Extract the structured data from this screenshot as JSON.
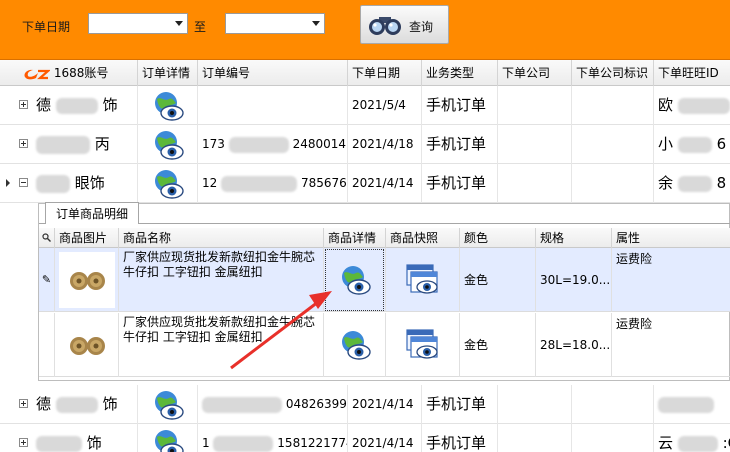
{
  "filter": {
    "date_label": "下单日期",
    "to_label": "至",
    "start_date_value": "",
    "end_date_value": "",
    "query_label": "查询"
  },
  "columns": [
    "1688账号",
    "订单详情",
    "订单编号",
    "下单日期",
    "业务类型",
    "下单公司",
    "下单公司标识",
    "下单旺旺ID"
  ],
  "orders": [
    {
      "account": "德",
      "account_suffix": "饰",
      "order_no": "",
      "date": "2021/5/4",
      "type": "手机订单",
      "wangwang": "欧"
    },
    {
      "account": "",
      "account_suffix": "丙",
      "order_no_prefix": "173",
      "order_no_suffix": "2480014",
      "date": "2021/4/18",
      "type": "手机订单",
      "wangwang": "小",
      "wangwang_suffix": "6"
    },
    {
      "account": "",
      "account_suffix": "眼饰",
      "order_no_prefix": "12",
      "order_no_suffix": "785676",
      "date": "2021/4/14",
      "type": "手机订单",
      "wangwang": "余",
      "wangwang_suffix": "8"
    },
    {
      "account": "德",
      "account_suffix": "饰",
      "order_no_suffix": "04826399",
      "date": "2021/4/14",
      "type": "手机订单",
      "wangwang": ""
    },
    {
      "account": "",
      "account_suffix": "饰",
      "order_no_prefix": "1",
      "order_no_suffix": "1581221774",
      "date": "2021/4/14",
      "type": "手机订单",
      "wangwang": "云",
      "wangwang_suffix": ":C"
    }
  ],
  "detail": {
    "tab_label": "订单商品明细",
    "columns": [
      "商品图片",
      "商品名称",
      "商品详情",
      "商品快照",
      "颜色",
      "规格",
      "属性"
    ],
    "items": [
      {
        "name": "厂家供应现货批发新款纽扣金牛腕芯牛仔扣 工字钮扣 金属纽扣",
        "color": "金色",
        "spec": "30L=19.0...",
        "attr": "运费险"
      },
      {
        "name": "厂家供应现货批发新款纽扣金牛腕芯牛仔扣 工字钮扣 金属纽扣",
        "color": "金色",
        "spec": "28L=18.0...",
        "attr": "运费险"
      }
    ]
  },
  "colors": {
    "toolbar": "#ff8a00",
    "selected_row": "#e3ebff",
    "arrow": "#e8302a",
    "logo": "#ff5a00"
  }
}
